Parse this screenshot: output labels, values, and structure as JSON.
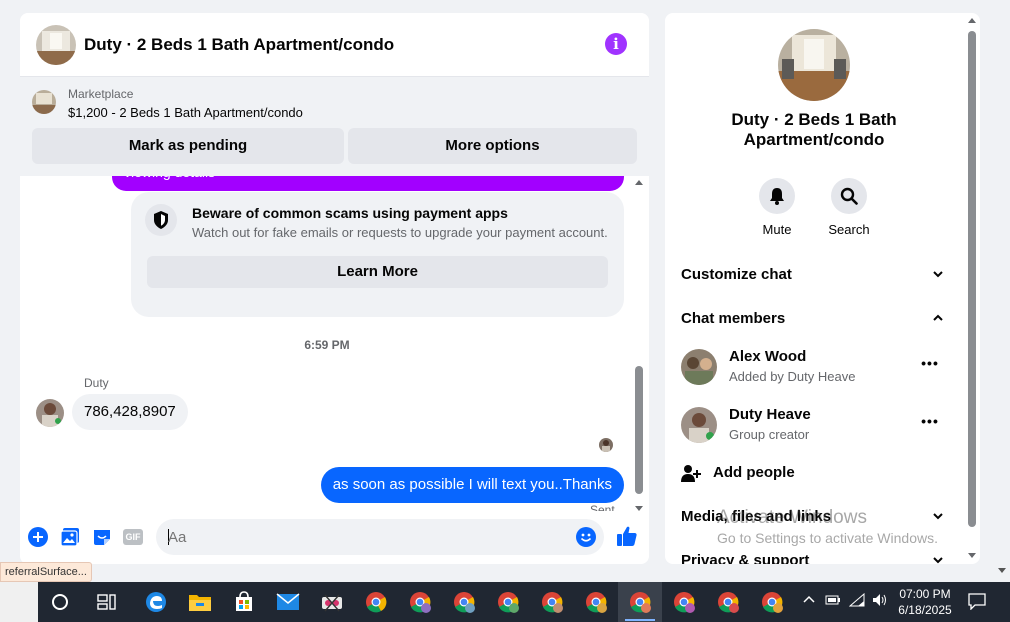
{
  "chat": {
    "title": "Duty · 2 Beds 1 Bath Apartment/condo",
    "marketplace_label": "Marketplace",
    "listing": "$1,200 - 2 Beds 1 Bath Apartment/condo",
    "mark_pending": "Mark as pending",
    "more_options": "More options",
    "purple_text": "viewing details",
    "scam_title": "Beware of common scams using payment apps",
    "scam_sub": "Watch out for fake emails or requests to upgrade your payment account.",
    "learn_more": "Learn More",
    "time": "6:59 PM",
    "sender": "Duty",
    "incoming": "786,428,8907",
    "outgoing": "as soon as possible I will text you..Thanks",
    "sent": "Sent",
    "placeholder": "Aa",
    "gif": "GIF"
  },
  "panel": {
    "title": "Duty · 2 Beds 1 Bath Apartment/condo",
    "mute": "Mute",
    "search": "Search",
    "customize": "Customize chat",
    "members_header": "Chat members",
    "members": [
      {
        "name": "Alex Wood",
        "sub": "Added by Duty Heave"
      },
      {
        "name": "Duty Heave",
        "sub": "Group creator"
      }
    ],
    "dots": "•••",
    "add_people": "Add people",
    "media": "Media, files and links",
    "privacy": "Privacy & support"
  },
  "watermark": {
    "line1": "Activate Windows",
    "line2": "Go to Settings to activate Windows."
  },
  "tooltip": "referralSurface...",
  "taskbar": {
    "time": "07:00 PM",
    "date": "6/18/2025"
  },
  "colors": {
    "accent_blue": "#0866ff",
    "accent_purple": "#a033ff",
    "purple_bubble": "#a200ff"
  }
}
